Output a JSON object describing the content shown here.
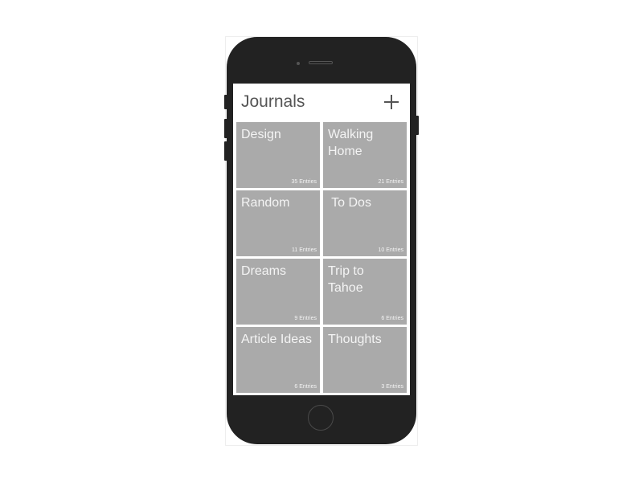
{
  "header": {
    "title": "Journals",
    "add_icon": "plus-icon"
  },
  "journals": [
    {
      "name": "Design",
      "count": "35 Entries"
    },
    {
      "name": "Walking Home",
      "count": "21 Entries"
    },
    {
      "name": "Random",
      "count": "11 Entries"
    },
    {
      "name": " To Dos",
      "count": "10 Entries"
    },
    {
      "name": "Dreams",
      "count": "9 Entries"
    },
    {
      "name": "Trip to Tahoe",
      "count": "6 Entries"
    },
    {
      "name": "Article Ideas",
      "count": "6 Entries"
    },
    {
      "name": "Thoughts",
      "count": "3 Entries"
    }
  ],
  "colors": {
    "tile": "#aaaaaa",
    "phone": "#222222",
    "title_text": "#555555"
  }
}
